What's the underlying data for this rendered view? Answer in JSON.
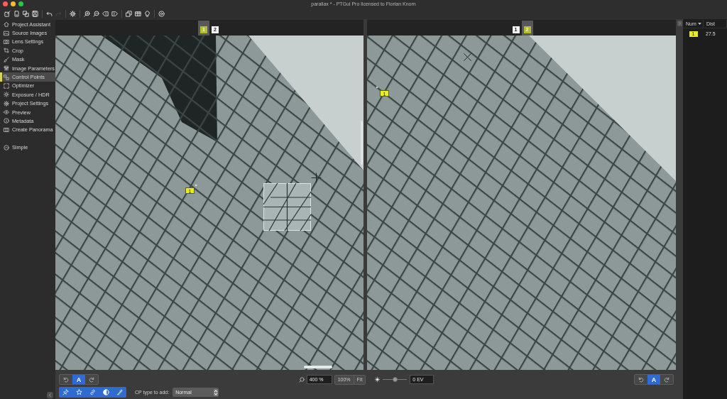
{
  "window": {
    "title": "parallax * - PTGui Pro licensed to Florian Knorn"
  },
  "toolbar": {
    "groups": [
      {
        "buttons": [
          {
            "kind": "new",
            "disabled": false
          },
          {
            "kind": "open",
            "disabled": false
          },
          {
            "kind": "duplicate",
            "disabled": false
          },
          {
            "kind": "save",
            "disabled": false
          }
        ]
      },
      {
        "buttons": [
          {
            "kind": "undo",
            "disabled": false
          },
          {
            "kind": "redo",
            "disabled": true
          }
        ]
      },
      {
        "buttons": [
          {
            "kind": "settings",
            "disabled": false
          }
        ]
      },
      {
        "buttons": [
          {
            "kind": "zoom-in",
            "disabled": false
          },
          {
            "kind": "zoom-out",
            "disabled": false
          },
          {
            "kind": "previous",
            "disabled": false
          },
          {
            "kind": "next",
            "disabled": false
          }
        ]
      },
      {
        "buttons": [
          {
            "kind": "windows",
            "disabled": false
          },
          {
            "kind": "table",
            "disabled": false
          },
          {
            "kind": "bulb",
            "disabled": false
          }
        ]
      },
      {
        "buttons": [
          {
            "kind": "help",
            "disabled": false
          }
        ]
      }
    ]
  },
  "sidebar": {
    "items": [
      {
        "kind": "assistant",
        "label": "Project Assistant",
        "selected": false
      },
      {
        "kind": "images",
        "label": "Source Images",
        "selected": false
      },
      {
        "kind": "lens",
        "label": "Lens Settings",
        "selected": false
      },
      {
        "kind": "crop",
        "label": "Crop",
        "selected": false
      },
      {
        "kind": "mask",
        "label": "Mask",
        "selected": false
      },
      {
        "kind": "parameters",
        "label": "Image Parameters",
        "selected": false
      },
      {
        "kind": "control-points",
        "label": "Control Points",
        "selected": true
      },
      {
        "kind": "optimizer",
        "label": "Optimizer",
        "selected": false
      },
      {
        "kind": "exposure",
        "label": "Exposure / HDR",
        "selected": false
      },
      {
        "kind": "settings",
        "label": "Project Settings",
        "selected": false
      },
      {
        "kind": "preview",
        "label": "Preview",
        "selected": false
      },
      {
        "kind": "metadata",
        "label": "Metadata",
        "selected": false
      },
      {
        "kind": "panorama",
        "label": "Create Panorama",
        "selected": false
      }
    ],
    "mode": {
      "label": "Simple"
    }
  },
  "panes": [
    {
      "image_tabs": [
        {
          "label": "1",
          "selected": true
        },
        {
          "label": "2",
          "selected": false
        }
      ],
      "control_points": [
        {
          "label": "1"
        }
      ],
      "loupe": true,
      "cursor": {
        "kind": "crosshair"
      },
      "scrollbars": true,
      "rotate": [
        {
          "kind": "rotate-left",
          "selected": false
        },
        {
          "kind": "auto",
          "label": "A",
          "selected": true
        },
        {
          "kind": "rotate-right",
          "selected": false
        }
      ]
    },
    {
      "image_tabs": [
        {
          "label": "1",
          "selected": false
        },
        {
          "label": "2",
          "selected": true
        }
      ],
      "control_points": [
        {
          "label": "1"
        }
      ],
      "cursor": {
        "kind": "cross"
      },
      "rotate": [
        {
          "kind": "rotate-left",
          "selected": false
        },
        {
          "kind": "auto",
          "label": "A",
          "selected": true
        },
        {
          "kind": "rotate-right",
          "selected": false
        }
      ]
    }
  ],
  "view_controls": {
    "zoom": {
      "value": "400 %"
    },
    "buttons": [
      {
        "label": "100%"
      },
      {
        "label": "Fit"
      }
    ],
    "exposure": {
      "level": 0.5,
      "value": "0 EV"
    }
  },
  "tools": {
    "buttons": [
      {
        "kind": "add-point",
        "on": true
      },
      {
        "kind": "star",
        "on": true
      },
      {
        "kind": "link",
        "on": true
      },
      {
        "kind": "contrast",
        "on": true
      },
      {
        "kind": "picker",
        "on": true
      }
    ],
    "cp_type": {
      "label": "CP type to add:",
      "value": "Normal"
    }
  },
  "points_table": {
    "columns": [
      {
        "label": "Num",
        "sorted": true
      },
      {
        "label": "Dist",
        "sorted": false
      }
    ],
    "rows": [
      {
        "num": "1",
        "dist": "27.5"
      }
    ]
  }
}
